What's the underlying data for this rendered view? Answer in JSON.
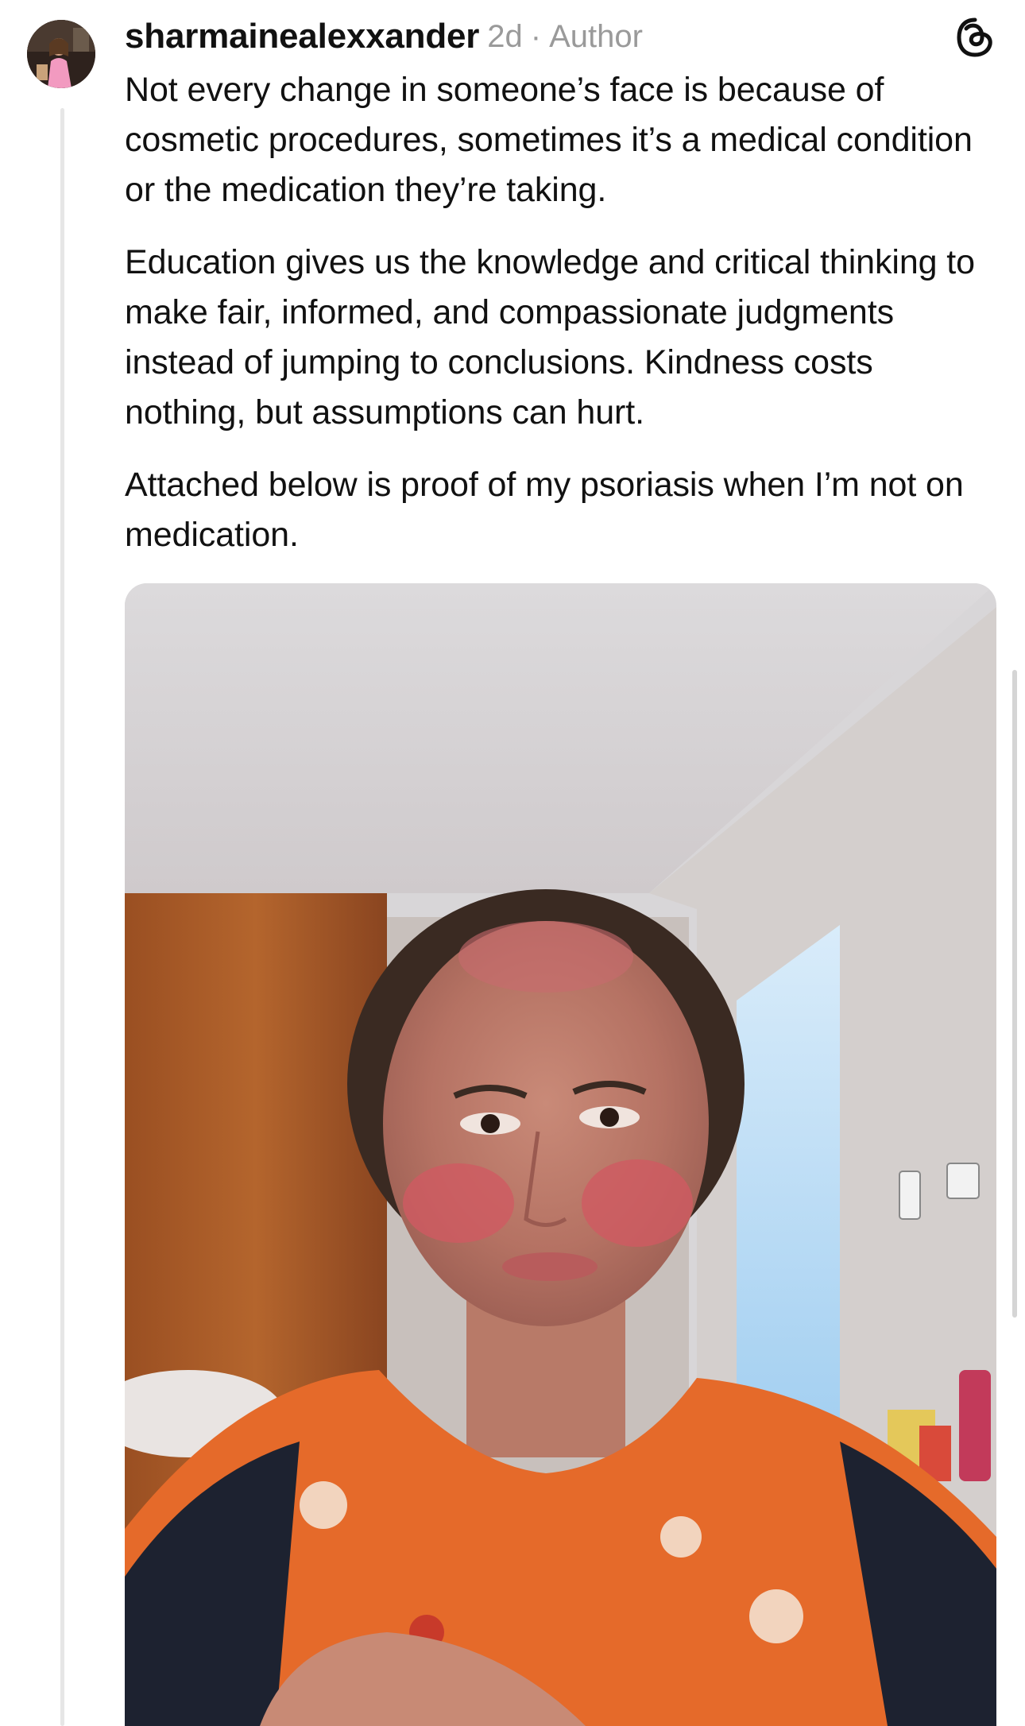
{
  "post": {
    "username": "sharmainealexxander",
    "time_ago": "2d",
    "separator": "·",
    "role_badge": "Author",
    "paragraphs": [
      "Not every change in someone’s face is because of cosmetic procedures, sometimes it’s a medical condition or the medication they’re taking.",
      "Education gives us the knowledge and critical thinking to make fair, informed, and compassionate judgments instead of jumping to conclusions. Kindness costs nothing, but assumptions can hurt.",
      "Attached below is proof of my psoriasis when I’m not on medication."
    ]
  },
  "icons": {
    "avatar": "profile-photo",
    "logo": "threads-logo-icon"
  },
  "colors": {
    "text": "#111111",
    "meta": "#9a9a9a",
    "thread_line": "#e6e6e6",
    "background": "#ffffff"
  }
}
